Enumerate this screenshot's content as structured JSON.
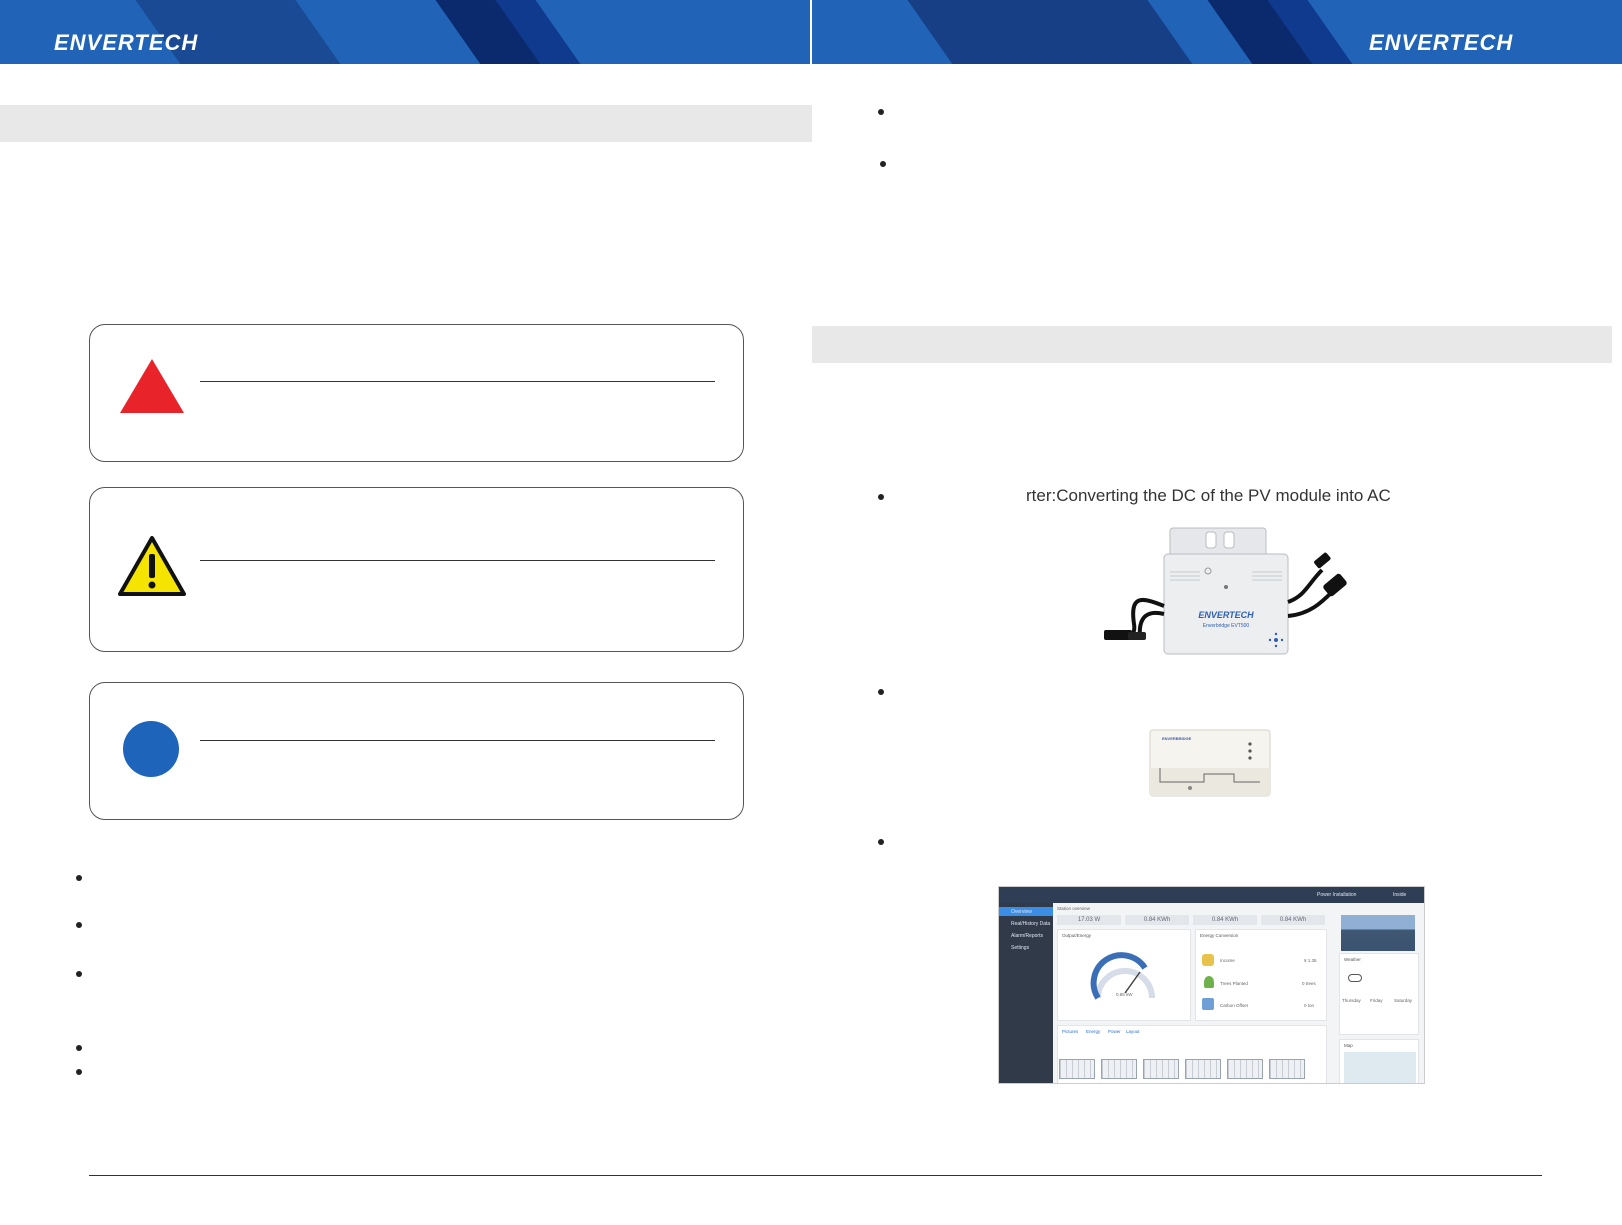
{
  "header": {
    "logo_left": "ENVERTECH",
    "logo_right": "ENVERTECH"
  },
  "notice_boxes": [
    {
      "icon": "danger-triangle-icon",
      "color": "#e8232a"
    },
    {
      "icon": "warning-triangle-icon",
      "color": "#f5e300"
    },
    {
      "icon": "info-circle-icon",
      "color": "#1f64bb"
    }
  ],
  "components": {
    "inverter_caption": "rter:Converting the DC of the PV module into AC",
    "inverter_brand": "ENVERTECH",
    "inverter_sub": "Enverbridge EVT500",
    "gateway_brand": "ENVERBRIDGE"
  },
  "dashboard": {
    "header_right": "Power Installation",
    "header_user": "Inside",
    "menu": [
      "Overview",
      "Real/History Data",
      "Alarm/Reports",
      "Settings"
    ],
    "filter": "Station overview",
    "stats": [
      "17.03 W",
      "0.84 KWh",
      "0.84 KWh",
      "0.84 KWh"
    ],
    "panels": {
      "output": "Output/Energy",
      "gauge_value": "0.85 kW",
      "conversion": "Energy Conversion",
      "income_label": "Income",
      "income_value": "¥ 1.35",
      "trees_label": "Trees Planted",
      "trees_value": "0 trees",
      "carbon_label": "Carbon Offset",
      "carbon_value": "0 ton",
      "weather": "Weather",
      "map": "Map"
    },
    "tabs": [
      "Pictures",
      "Energy",
      "Power",
      "Layout"
    ],
    "weather_days": [
      "Thursday",
      "Friday",
      "Saturday"
    ]
  }
}
